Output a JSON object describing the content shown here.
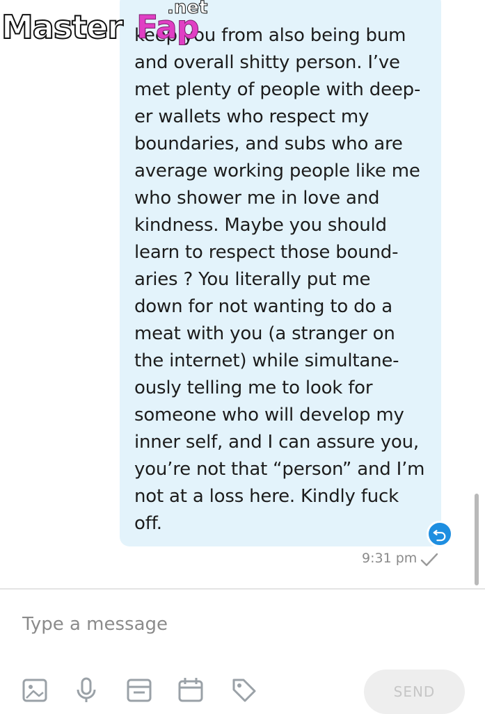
{
  "message": {
    "lines": [
      "keep you from also being bum",
      "and overall shitty person. I’ve",
      "met plenty of people with deep-",
      "er wallets who respect my",
      "boundaries, and subs who are",
      "average working people like me",
      "who shower me in love and",
      "kindness. Maybe you should",
      "learn to respect those bound-",
      "aries ? You literally put me",
      "down for not wanting to do a",
      "meat with you (a stranger on",
      "the internet) while simultane-",
      "ously telling me to look for",
      "someone who will develop my",
      "inner self, and I can assure you,",
      "you’re not that “person” and I’m",
      "not at a loss here. Kindly fuck",
      "off."
    ],
    "timestamp": "9:31 pm",
    "status_icon": "single-check-icon",
    "bubble_color": "#e3f3fb"
  },
  "composer": {
    "placeholder": "Type a message",
    "tools": [
      "image-icon",
      "microphone-icon",
      "vault-icon",
      "calendar-icon",
      "tag-icon"
    ],
    "send_label": "SEND"
  },
  "watermark": {
    "part1": "Master",
    "part2": "Fap",
    "part3": ".net"
  },
  "colors": {
    "accent": "#1e8ee0",
    "timestamp": "#8a8a8a",
    "watermark_pink": "#e03fc4"
  }
}
